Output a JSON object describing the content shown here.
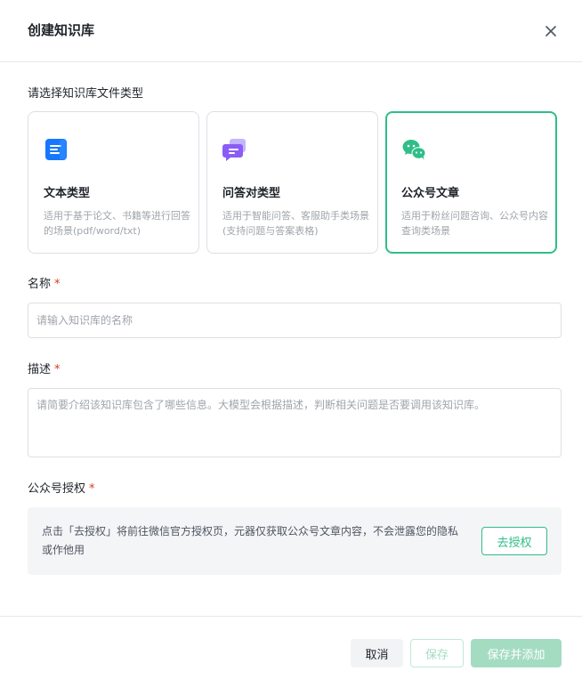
{
  "dialog": {
    "title": "创建知识库",
    "close_icon": "close-icon"
  },
  "type_section": {
    "label": "请选择知识库文件类型",
    "cards": [
      {
        "name": "文本类型",
        "description": "适用于基于论文、书籍等进行回答的场景(pdf/word/txt)",
        "icon": "document-icon",
        "color": "#1677ff",
        "selected": false
      },
      {
        "name": "问答对类型",
        "description": "适用于智能问答、客服助手类场景(支持问题与答案表格)",
        "icon": "qa-chat-icon",
        "color": "#8b5cf6",
        "selected": false
      },
      {
        "name": "公众号文章",
        "description": "适用于粉丝问题咨询、公众号内容查询类场景",
        "icon": "wechat-icon",
        "color": "#2fbe88",
        "selected": true
      }
    ]
  },
  "name_field": {
    "label": "名称",
    "required_mark": "*",
    "placeholder": "请输入知识库的名称",
    "value": ""
  },
  "description_field": {
    "label": "描述",
    "required_mark": "*",
    "placeholder": "请简要介绍该知识库包含了哪些信息。大模型会根据描述，判断相关问题是否要调用该知识库。",
    "value": ""
  },
  "auth_section": {
    "label": "公众号授权",
    "required_mark": "*",
    "notice": "点击「去授权」将前往微信官方授权页，元器仅获取公众号文章内容，不会泄露您的隐私或作他用",
    "button_label": "去授权"
  },
  "footer": {
    "cancel_label": "取消",
    "save_label": "保存",
    "save_and_add_label": "保存并添加"
  },
  "colors": {
    "accent": "#2fbe88",
    "accent_disabled": "#a4dcc2",
    "required": "#d9381e"
  }
}
